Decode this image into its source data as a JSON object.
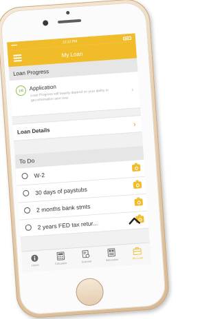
{
  "status_bar": {
    "signal": "•••••",
    "time": "12:12 PM"
  },
  "header": {
    "title": "My Loan"
  },
  "loan_progress": {
    "section_label": "Loan Progress",
    "step_badge": "1/6",
    "step_title": "Application",
    "step_description": "Loan Progress will heavily depend on your ability to get information sent over."
  },
  "loan_details": {
    "label": "Loan Details"
  },
  "todo": {
    "section_label": "To Do",
    "items": [
      {
        "label": "W-2"
      },
      {
        "label": "30 days of paystubs"
      },
      {
        "label": "2 months bank stmts"
      },
      {
        "label": "2 years FED tax retur..."
      }
    ]
  },
  "tabbar": {
    "tabs": [
      {
        "label": "Home",
        "icon": "info-icon"
      },
      {
        "label": "Calculator",
        "icon": "calculator-icon"
      },
      {
        "label": "Scanner",
        "icon": "scanner-icon"
      },
      {
        "label": "Education",
        "icon": "education-icon"
      },
      {
        "label": "My Loan",
        "icon": "briefcase-icon",
        "active": true
      }
    ]
  },
  "colors": {
    "accent": "#f1bc2a",
    "progress_ring": "#8cc63f"
  }
}
